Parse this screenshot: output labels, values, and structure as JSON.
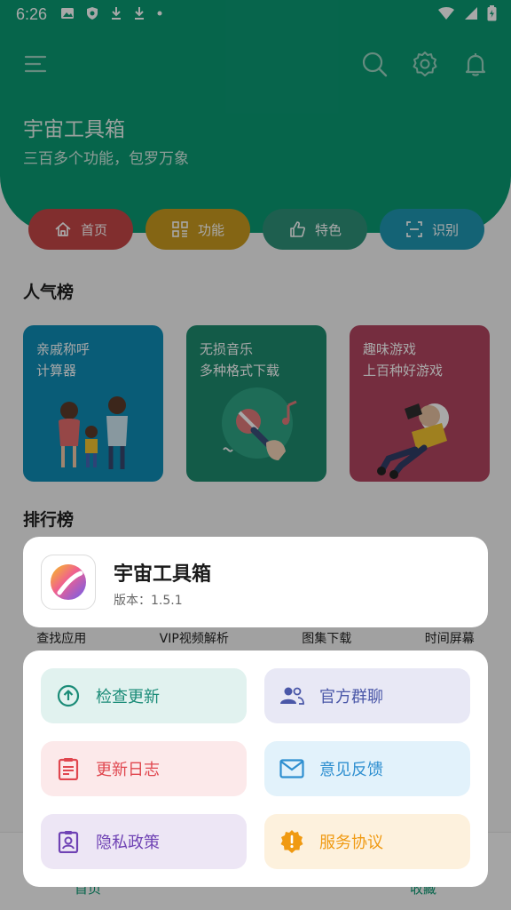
{
  "status": {
    "time": "6:26",
    "left_icons": [
      "image-icon",
      "shield-icon",
      "download-icon",
      "download-icon",
      "dot-icon"
    ],
    "right_icons": [
      "wifi-icon",
      "signal-icon",
      "battery-charging-icon"
    ]
  },
  "toolbar": {
    "icons": [
      "menu-icon",
      "search-icon",
      "settings-icon",
      "bell-icon"
    ]
  },
  "hero": {
    "title": "宇宙工具箱",
    "subtitle": "三百多个功能，包罗万象"
  },
  "tabs": [
    {
      "label": "首页",
      "icon": "home-icon",
      "color": "#c44747"
    },
    {
      "label": "功能",
      "icon": "grid-icon",
      "color": "#c99a1f"
    },
    {
      "label": "特色",
      "icon": "thumb-up-icon",
      "color": "#2e9079"
    },
    {
      "label": "识别",
      "icon": "scan-icon",
      "color": "#1f97b2"
    }
  ],
  "popular": {
    "title": "人气榜",
    "cards": [
      {
        "line1": "亲戚称呼",
        "line2": "计算器",
        "color": "#0f8cb5"
      },
      {
        "line1": "无损音乐",
        "line2": "多种格式下载",
        "color": "#1d8a6e"
      },
      {
        "line1": "趣味游戏",
        "line2": "上百种好游戏",
        "color": "#b24560"
      }
    ]
  },
  "ranking": {
    "title": "排行榜",
    "items": [
      "查找应用",
      "VIP视频解析",
      "图集下载",
      "时间屏幕"
    ]
  },
  "bottom_nav": {
    "left": "首页",
    "right": "收藏"
  },
  "dialog": {
    "app_name": "宇宙工具箱",
    "version": "版本：1.5.1",
    "actions": [
      {
        "label": "检查更新",
        "icon": "upload-circle-icon",
        "bg": "#e1f2ef",
        "fg": "#1b8c78"
      },
      {
        "label": "官方群聊",
        "icon": "group-icon",
        "bg": "#e8e8f5",
        "fg": "#4a57a8"
      },
      {
        "label": "更新日志",
        "icon": "clipboard-icon",
        "bg": "#fce9ea",
        "fg": "#e0474f"
      },
      {
        "label": "意见反馈",
        "icon": "mail-icon",
        "bg": "#e2f2fb",
        "fg": "#2e8fd0"
      },
      {
        "label": "隐私政策",
        "icon": "badge-icon",
        "bg": "#ede6f5",
        "fg": "#6f42b4"
      },
      {
        "label": "服务协议",
        "icon": "alert-gear-icon",
        "bg": "#fdf1dd",
        "fg": "#f09a12"
      }
    ]
  }
}
